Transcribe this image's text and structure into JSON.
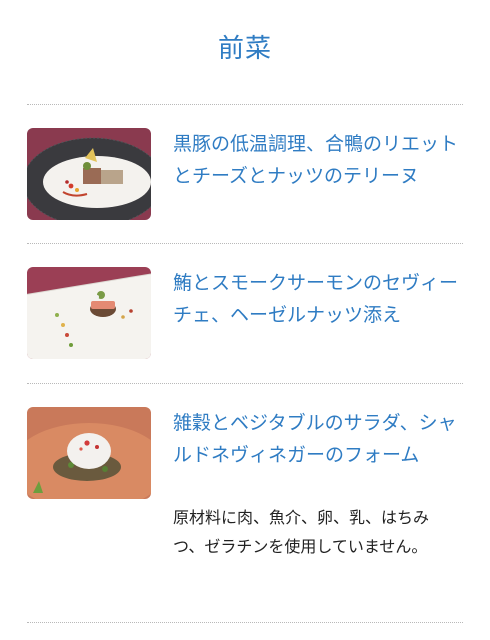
{
  "section": {
    "title": "前菜"
  },
  "items": [
    {
      "name": "黒豚の低温調理、合鴨のリエットとチーズとナッツのテリーヌ",
      "image": "dish-terrine-photo"
    },
    {
      "name": "鮪とスモークサーモンのセヴィーチェ、ヘーゼルナッツ添え",
      "image": "dish-ceviche-photo"
    },
    {
      "name": "雑穀とベジタブルのサラダ、シャルドネヴィネガーのフォーム",
      "image": "dish-salad-photo",
      "note": "原材料に肉、魚介、卵、乳、はちみつ、ゼラチンを使用していません。"
    }
  ],
  "colors": {
    "accent": "#2f7cc3",
    "divider": "#b9b9b9",
    "text": "#222222"
  }
}
